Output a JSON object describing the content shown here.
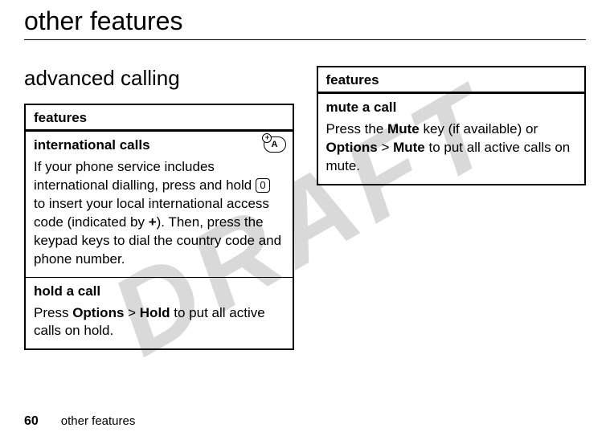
{
  "watermark": "DRAFT",
  "page_title": "other features",
  "section_heading": "advanced calling",
  "left_table": {
    "header": "features",
    "rows": [
      {
        "title": "international calls",
        "icon": "network-roaming-icon",
        "icon_letter": "A",
        "icon_plus": "+",
        "body_pre": "If your phone service includes international dialling, press and hold ",
        "key": "0",
        "body_mid": " to insert your local international access code (indicated by ",
        "plus": "+",
        "body_post": "). Then, press the keypad keys to dial the country code and phone number."
      },
      {
        "title": "hold a call",
        "body_pre": "Press ",
        "opt1": "Options",
        "sep": " > ",
        "opt2": "Hold",
        "body_post": " to put all active calls on hold."
      }
    ]
  },
  "right_table": {
    "header": "features",
    "rows": [
      {
        "title": "mute a call",
        "body_pre": "Press the ",
        "mute1": "Mute",
        "body_mid": " key (if available) or ",
        "opt1": "Options",
        "sep": " > ",
        "mute2": "Mute",
        "body_post": " to put all active calls on mute."
      }
    ]
  },
  "footer": {
    "page_number": "60",
    "section": "other features"
  }
}
